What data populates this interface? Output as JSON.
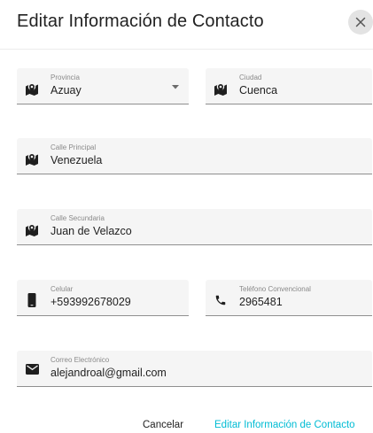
{
  "dialog": {
    "title": "Editar Información de Contacto",
    "close_icon": "close-icon"
  },
  "fields": {
    "provincia": {
      "label": "Provincia",
      "value": "Azuay",
      "icon": "map-icon"
    },
    "ciudad": {
      "label": "Ciudad",
      "value": "Cuenca",
      "icon": "map-icon"
    },
    "calle_principal": {
      "label": "Calle Principal",
      "value": "Venezuela",
      "icon": "map-icon"
    },
    "calle_secundaria": {
      "label": "Calle Secundaria",
      "value": "Juan de Velazco",
      "icon": "map-icon"
    },
    "celular": {
      "label": "Celular",
      "value": "+593992678029",
      "icon": "smartphone-icon"
    },
    "telefono": {
      "label": "Teléfono Convencional",
      "value": "2965481",
      "icon": "phone-icon"
    },
    "correo": {
      "label": "Correo Electrónico",
      "value": "alejandroal@gmail.com",
      "icon": "email-icon"
    }
  },
  "actions": {
    "cancel_label": "Cancelar",
    "save_label": "Editar Información de Contacto"
  },
  "colors": {
    "accent": "#00bcd4",
    "field_background": "#f5f5f5",
    "close_button_background": "#e3e3e3"
  }
}
